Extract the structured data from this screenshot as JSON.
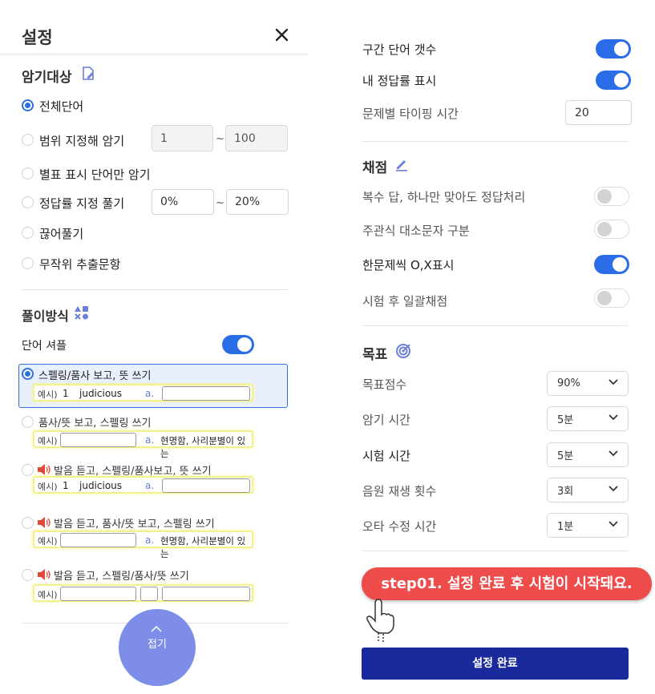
{
  "panel_left": {
    "title": "설정",
    "target_section": {
      "title": "암기대상",
      "options": [
        {
          "label": "전체단어",
          "selected": true
        },
        {
          "label": "범위 지정해 암기",
          "selected": false,
          "from": "1",
          "sep": "~",
          "to": "100"
        },
        {
          "label": "별표 표시 단어만 암기",
          "selected": false
        },
        {
          "label": "정답률 지정 풀기",
          "selected": false,
          "from": "0%",
          "sep": "~",
          "to": "20%"
        },
        {
          "label": "끊어풀기",
          "selected": false
        },
        {
          "label": "무작위 추출문항",
          "selected": false
        }
      ]
    },
    "method_section": {
      "title": "풀이방식",
      "shuffle_label": "단어 셔플",
      "shuffle_on": true,
      "options": [
        {
          "label": "스펠링/품사 보고, 뜻 쓰기",
          "selected": true,
          "audio": false,
          "example": {
            "prefix": "예시)",
            "num": "1",
            "word": "judicious",
            "a": "a.",
            "answer": ""
          }
        },
        {
          "label": "품사/뜻 보고, 스펠링 쓰기",
          "selected": false,
          "audio": false,
          "example": {
            "prefix": "예시)",
            "a": "a.",
            "meaning": "현명함, 사리분별이 있는"
          }
        },
        {
          "label": "발음 듣고, 스펠링/품사보고, 뜻 쓰기",
          "selected": false,
          "audio": true,
          "example": {
            "prefix": "예시)",
            "num": "1",
            "word": "judicious",
            "a": "a."
          }
        },
        {
          "label": "발음 듣고, 품사/뜻 보고, 스펠링 쓰기",
          "selected": false,
          "audio": true,
          "example": {
            "prefix": "예시)",
            "a": "a.",
            "meaning": "현명함, 사리분별이 있는"
          }
        },
        {
          "label": "발음 듣고, 스펠링/품사/뜻 쓰기",
          "selected": false,
          "audio": true,
          "example": {
            "prefix": "예시)"
          }
        }
      ]
    },
    "collapse_label": "접기"
  },
  "panel_right": {
    "settings": [
      {
        "label": "구간 단어 갯수",
        "on": true
      },
      {
        "label": "내 정답률 표시",
        "on": true
      }
    ],
    "typing_time": {
      "label": "문제별 타이핑 시간",
      "value": "20"
    },
    "grading": {
      "title": "채점",
      "items": [
        {
          "label": "복수 답, 하나만 맞아도 정답처리",
          "on": false
        },
        {
          "label": "주관식 대소문자 구분",
          "on": false
        },
        {
          "label": "한문제씩 O,X표시",
          "on": true
        },
        {
          "label": "시험 후 일괄채점",
          "on": false
        }
      ]
    },
    "goal": {
      "title": "목표",
      "items": [
        {
          "label": "목표점수",
          "value": "90%"
        },
        {
          "label": "암기 시간",
          "value": "5분"
        },
        {
          "label": "시험 시간",
          "value": "5분"
        },
        {
          "label": "음원 재생 횟수",
          "value": "3회"
        },
        {
          "label": "오타 수정 시간",
          "value": "1분"
        }
      ]
    },
    "tooltip": "step01. 설정 완료 후 시험이 시작돼요.",
    "submit_label": "설정 완료"
  },
  "colors": {
    "accent": "#2b6de8",
    "submit": "#1a2a9c",
    "tooltip": "#ee4b4b",
    "collapse": "#7e8ee8"
  },
  "icons": [
    "close-icon",
    "edit-document-icon",
    "shapes-icon",
    "audio-icon",
    "pencil-icon",
    "target-icon",
    "chevron-down-icon",
    "chevron-up-icon",
    "pointing-hand-icon"
  ]
}
